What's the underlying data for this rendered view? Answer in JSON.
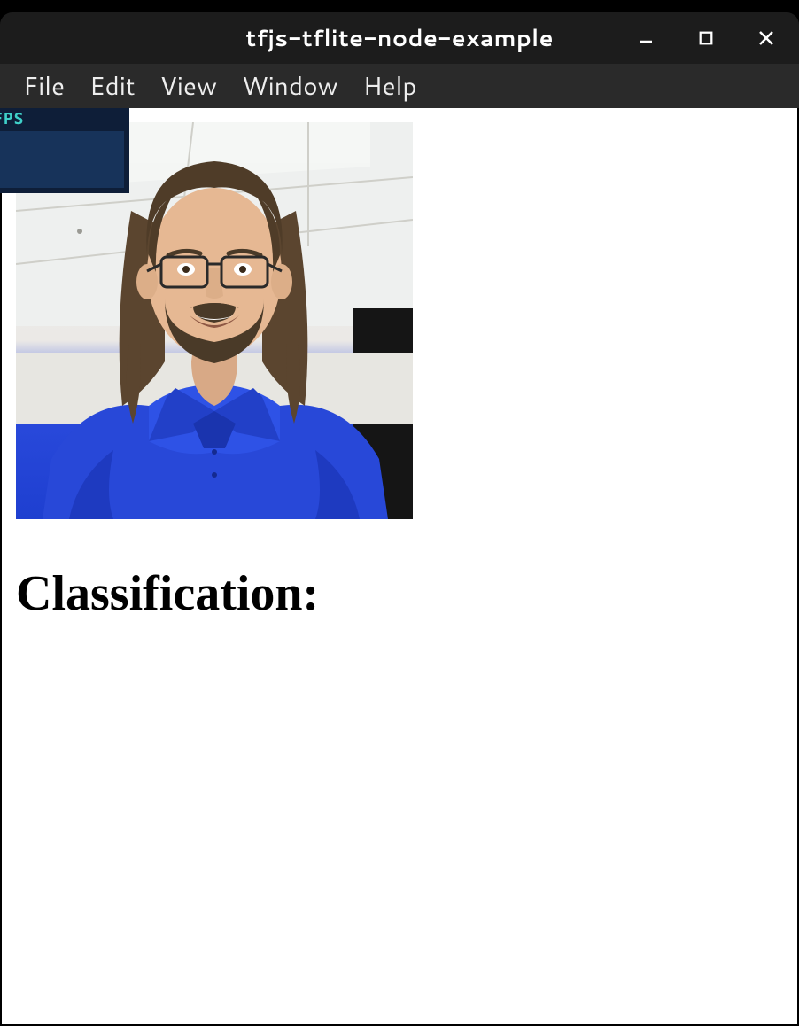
{
  "window": {
    "title": "tfjs-tflite-node-example"
  },
  "menubar": {
    "items": [
      {
        "label": "File"
      },
      {
        "label": "Edit"
      },
      {
        "label": "View"
      },
      {
        "label": "Window"
      },
      {
        "label": "Help"
      }
    ]
  },
  "fps": {
    "label": "FPS"
  },
  "main": {
    "classification_heading": "Classification:"
  }
}
